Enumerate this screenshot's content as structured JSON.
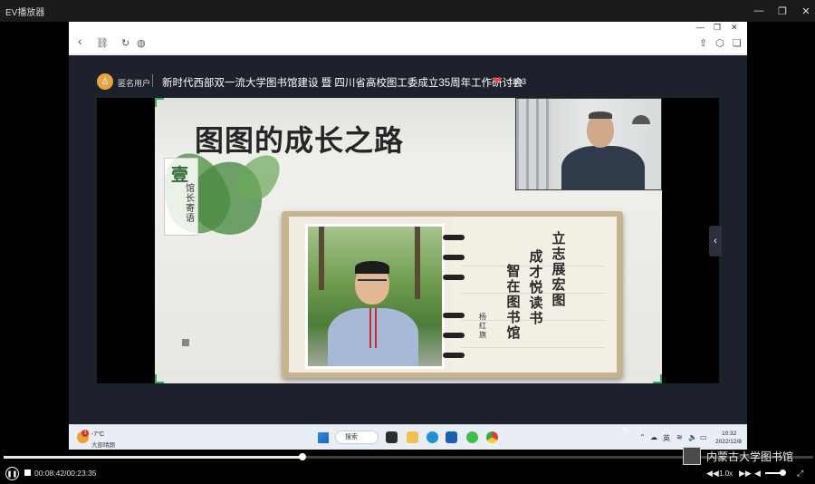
{
  "player": {
    "title": "EV播放器",
    "window_min": "—",
    "window_max": "❐",
    "window_close": "✕",
    "elapsed": "00:08:42",
    "total": "00:23:35",
    "time_display": "00:08:42/00:23:35",
    "progress": 0.369,
    "speed": "1.0x",
    "volume_level": 0.75,
    "watermark_text": "内蒙古大学图书馆"
  },
  "browser": {
    "back_icon": "‹",
    "link_icon": "⛓",
    "reload_icon": "↻",
    "globe_icon": "◍",
    "share_icon": "⇪",
    "cube_icon": "⬡",
    "doc_icon": "❏",
    "win_min": "—",
    "win_max": "❐",
    "win_close": "✕"
  },
  "live": {
    "user": "匿名用户",
    "title": "新时代西部双一流大学图书馆建设 暨 四川省高校图工委成立35周年工作研讨会",
    "likes": "1303",
    "slide": {
      "title": "图图的成长之路",
      "seal_big": "壹",
      "seal_sub": "馆长寄语",
      "poem_lines": [
        "立志展宏图",
        "成才悦读书",
        "智在图书馆"
      ],
      "author": "杨红旗"
    }
  },
  "taskbar": {
    "weather_badge": "1",
    "weather_temp": "-7°C",
    "weather_desc": "大部晴朗",
    "search_label": "搜索",
    "ime": "英",
    "time": "10:32",
    "date": "2022/12/8"
  },
  "colors": {
    "accent_green": "#2ab462",
    "heart": "#e8434f",
    "live_bg": "#1d212b"
  }
}
